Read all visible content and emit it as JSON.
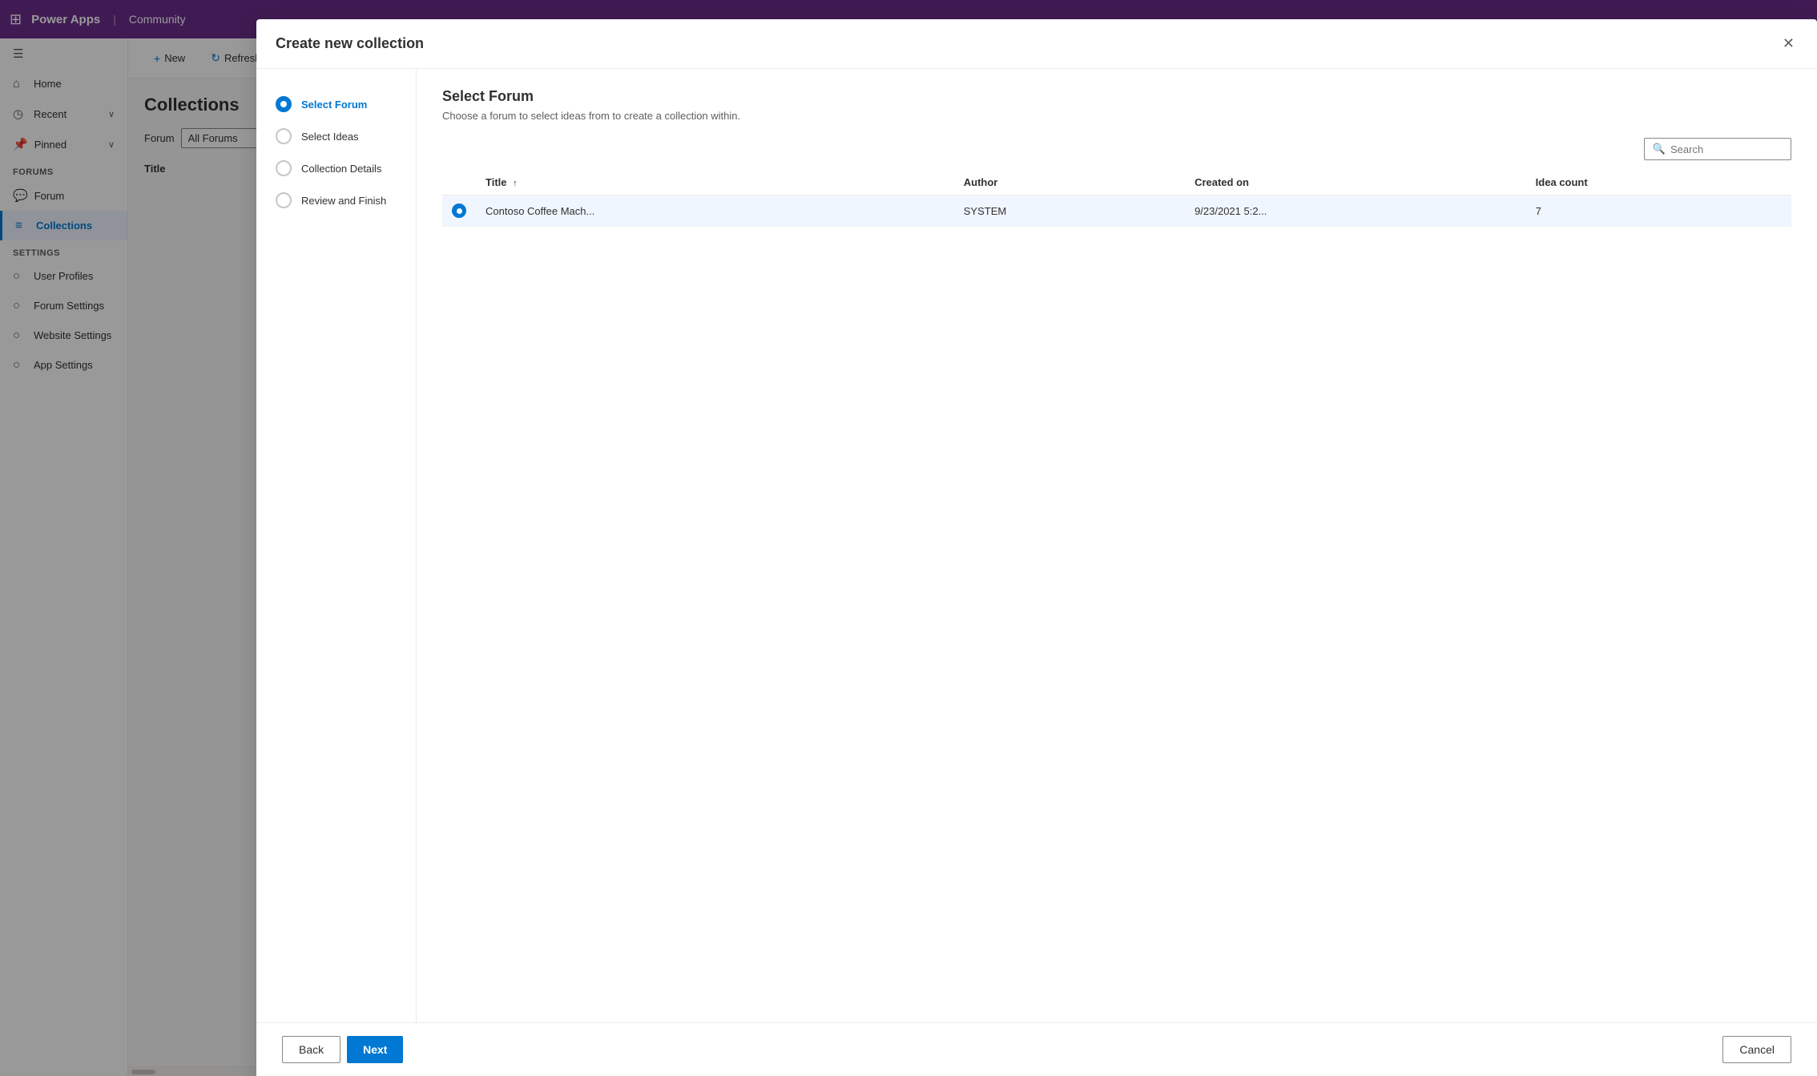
{
  "topbar": {
    "waffle": "⊞",
    "app_name": "Power Apps",
    "separator": "|",
    "community": "Community"
  },
  "sidebar": {
    "items": [
      {
        "id": "menu",
        "label": "",
        "icon": "☰",
        "type": "icon-only"
      },
      {
        "id": "home",
        "label": "Home",
        "icon": "🏠"
      },
      {
        "id": "recent",
        "label": "Recent",
        "icon": "🕐",
        "expandable": true
      },
      {
        "id": "pinned",
        "label": "Pinned",
        "icon": "📌",
        "expandable": true
      }
    ],
    "forums_section": "Forums",
    "forum_items": [
      {
        "id": "forum",
        "label": "Forum",
        "icon": "💬"
      },
      {
        "id": "collections",
        "label": "Collections",
        "icon": "≡",
        "active": true
      }
    ],
    "settings_section": "Settings",
    "settings_items": [
      {
        "id": "user-profiles",
        "label": "User Profiles",
        "icon": "👤"
      },
      {
        "id": "forum-settings",
        "label": "Forum Settings",
        "icon": "⚙"
      },
      {
        "id": "website-settings",
        "label": "Website Settings",
        "icon": "🌐"
      },
      {
        "id": "app-settings",
        "label": "App Settings",
        "icon": "⚙"
      }
    ]
  },
  "toolbar": {
    "new_label": "New",
    "refresh_label": "Refresh"
  },
  "collections_page": {
    "title": "Collections",
    "forum_label": "Forum",
    "forum_placeholder": "All Forums",
    "table_col_title": "Title"
  },
  "modal": {
    "title": "Create new collection",
    "steps": [
      {
        "id": "select-forum",
        "label": "Select Forum",
        "active": true
      },
      {
        "id": "select-ideas",
        "label": "Select Ideas",
        "active": false
      },
      {
        "id": "collection-details",
        "label": "Collection Details",
        "active": false
      },
      {
        "id": "review-finish",
        "label": "Review and Finish",
        "active": false
      }
    ],
    "content_title": "Select Forum",
    "content_desc": "Choose a forum to select ideas from to create a collection within.",
    "search_placeholder": "Search",
    "table": {
      "columns": [
        {
          "id": "title",
          "label": "Title",
          "sort": "asc"
        },
        {
          "id": "author",
          "label": "Author"
        },
        {
          "id": "created_on",
          "label": "Created on"
        },
        {
          "id": "idea_count",
          "label": "Idea count"
        }
      ],
      "rows": [
        {
          "selected": true,
          "title": "Contoso Coffee Mach...",
          "author": "SYSTEM",
          "created_on": "9/23/2021 5:2...",
          "idea_count": "7"
        }
      ]
    },
    "back_label": "Back",
    "next_label": "Next",
    "cancel_label": "Cancel"
  }
}
